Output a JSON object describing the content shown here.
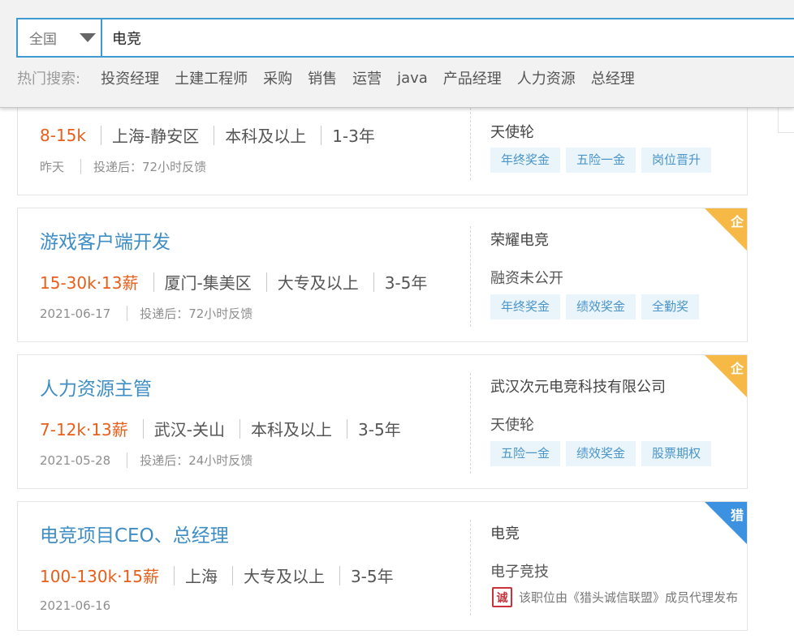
{
  "search": {
    "region": "全国",
    "query": "电竞",
    "hot_label": "热门搜索:",
    "hot_items": [
      "投资经理",
      "土建工程师",
      "采购",
      "销售",
      "运营",
      "java",
      "产品经理",
      "人力资源",
      "总经理"
    ]
  },
  "jobs": [
    {
      "title": "",
      "salary": "8-15k",
      "location": "上海-静安区",
      "education": "本科及以上",
      "experience": "1-3年",
      "date": "昨天",
      "feedback": "投递后：72小时反馈",
      "company": "天使轮",
      "industry": "",
      "tags": [
        "年终奖金",
        "五险一金",
        "岗位晋升"
      ],
      "badge": ""
    },
    {
      "title": "游戏客户端开发",
      "salary": "15-30k·13薪",
      "location": "厦门-集美区",
      "education": "大专及以上",
      "experience": "3-5年",
      "date": "2021-06-17",
      "feedback": "投递后：72小时反馈",
      "company": "荣耀电竞",
      "industry": "融资未公开",
      "tags": [
        "年终奖金",
        "绩效奖金",
        "全勤奖"
      ],
      "badge": "企"
    },
    {
      "title": "人力资源主管",
      "salary": "7-12k·13薪",
      "location": "武汉-关山",
      "education": "本科及以上",
      "experience": "3-5年",
      "date": "2021-05-28",
      "feedback": "投递后：24小时反馈",
      "company": "武汉次元电竞科技有限公司",
      "industry": "天使轮",
      "tags": [
        "五险一金",
        "绩效奖金",
        "股票期权"
      ],
      "badge": "企"
    },
    {
      "title": "电竞项目CEO、总经理",
      "salary": "100-130k·15薪",
      "location": "上海",
      "education": "大专及以上",
      "experience": "3-5年",
      "date": "2021-06-16",
      "feedback": "",
      "company": "电竞",
      "industry": "电子竞技",
      "tags": [],
      "badge": "猎",
      "notice_icon": "诚",
      "notice": "该职位由《猎头诚信联盟》成员代理发布"
    }
  ],
  "colors": {
    "accent": "#3e9bd1",
    "salary": "#e85e1a",
    "title": "#3e8ec5",
    "badge_company": "#f7b946",
    "badge_headhunter": "#3c92e0"
  }
}
